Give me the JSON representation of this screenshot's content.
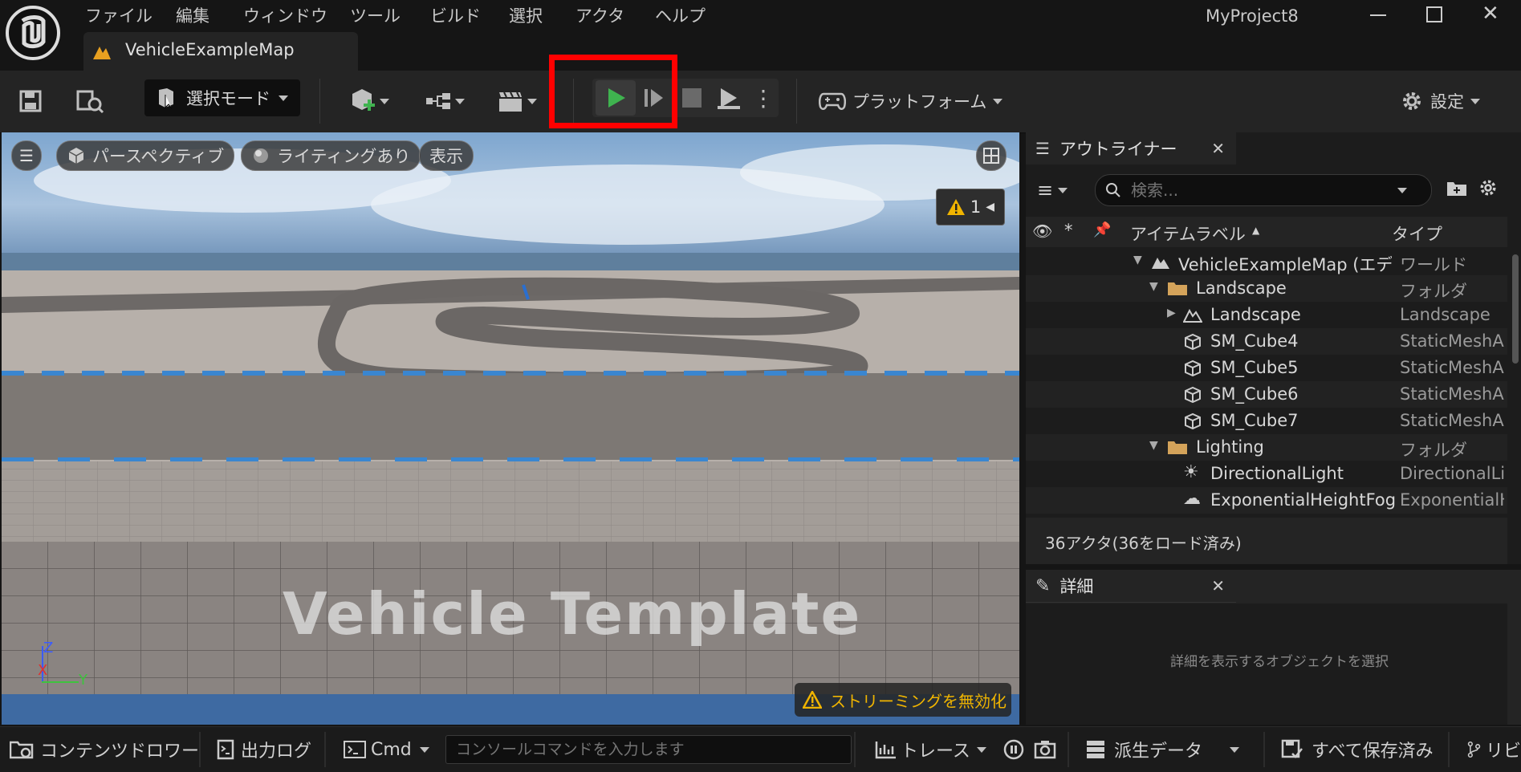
{
  "app": {
    "title": "MyProject8",
    "doc_tab": "VehicleExampleMap"
  },
  "menu": [
    "ファイル",
    "編集",
    "ウィンドウ",
    "ツール",
    "ビルド",
    "選択",
    "アクタ",
    "ヘルプ"
  ],
  "toolbar": {
    "mode_label": "選択モード",
    "platform_label": "プラットフォーム",
    "settings_label": "設定"
  },
  "viewport": {
    "perspective": "パースペクティブ",
    "lighting": "ライティングあり",
    "show": "表示",
    "warning_count": "1",
    "watermark": "Vehicle Template",
    "streaming_warning": "ストリーミングを無効化",
    "axes": {
      "z": "Z",
      "x": "X",
      "y": "Y"
    }
  },
  "outliner": {
    "tab_title": "アウトライナー",
    "search_placeholder": "検索...",
    "col_label": "アイテムラベル",
    "col_type": "タイプ",
    "rows": [
      {
        "label": "VehicleExampleMap (エディタ)",
        "type": "ワールド",
        "icon": "world-icon"
      },
      {
        "label": "Landscape",
        "type": "フォルダ",
        "icon": "folder-icon"
      },
      {
        "label": "Landscape",
        "type": "Landscape",
        "icon": "landscape-icon"
      },
      {
        "label": "SM_Cube4",
        "type": "StaticMeshActor",
        "icon": "cube-icon"
      },
      {
        "label": "SM_Cube5",
        "type": "StaticMeshActor",
        "icon": "cube-icon"
      },
      {
        "label": "SM_Cube6",
        "type": "StaticMeshActor",
        "icon": "cube-icon"
      },
      {
        "label": "SM_Cube7",
        "type": "StaticMeshActor",
        "icon": "cube-icon"
      },
      {
        "label": "Lighting",
        "type": "フォルダ",
        "icon": "folder-icon"
      },
      {
        "label": "DirectionalLight",
        "type": "DirectionalLight",
        "icon": "sun-icon"
      },
      {
        "label": "ExponentialHeightFog",
        "type": "ExponentialHeightFog",
        "icon": "fog-icon"
      }
    ],
    "footer": "36アクタ(36をロード済み)"
  },
  "details": {
    "tab_title": "詳細",
    "empty_text": "詳細を表示するオブジェクトを選択"
  },
  "statusbar": {
    "content_drawer": "コンテンツドロワー",
    "output_log": "出力ログ",
    "cmd": "Cmd",
    "console_placeholder": "コンソールコマンドを入力します",
    "trace": "トレース",
    "derived_data": "派生データ",
    "save_all": "すべて保存済み",
    "revision": "リビ"
  },
  "colors": {
    "accent_play": "#3fb34f",
    "highlight_box": "#ff0000",
    "warning": "#f0b400",
    "bg": "#151515",
    "panel": "#242424"
  }
}
